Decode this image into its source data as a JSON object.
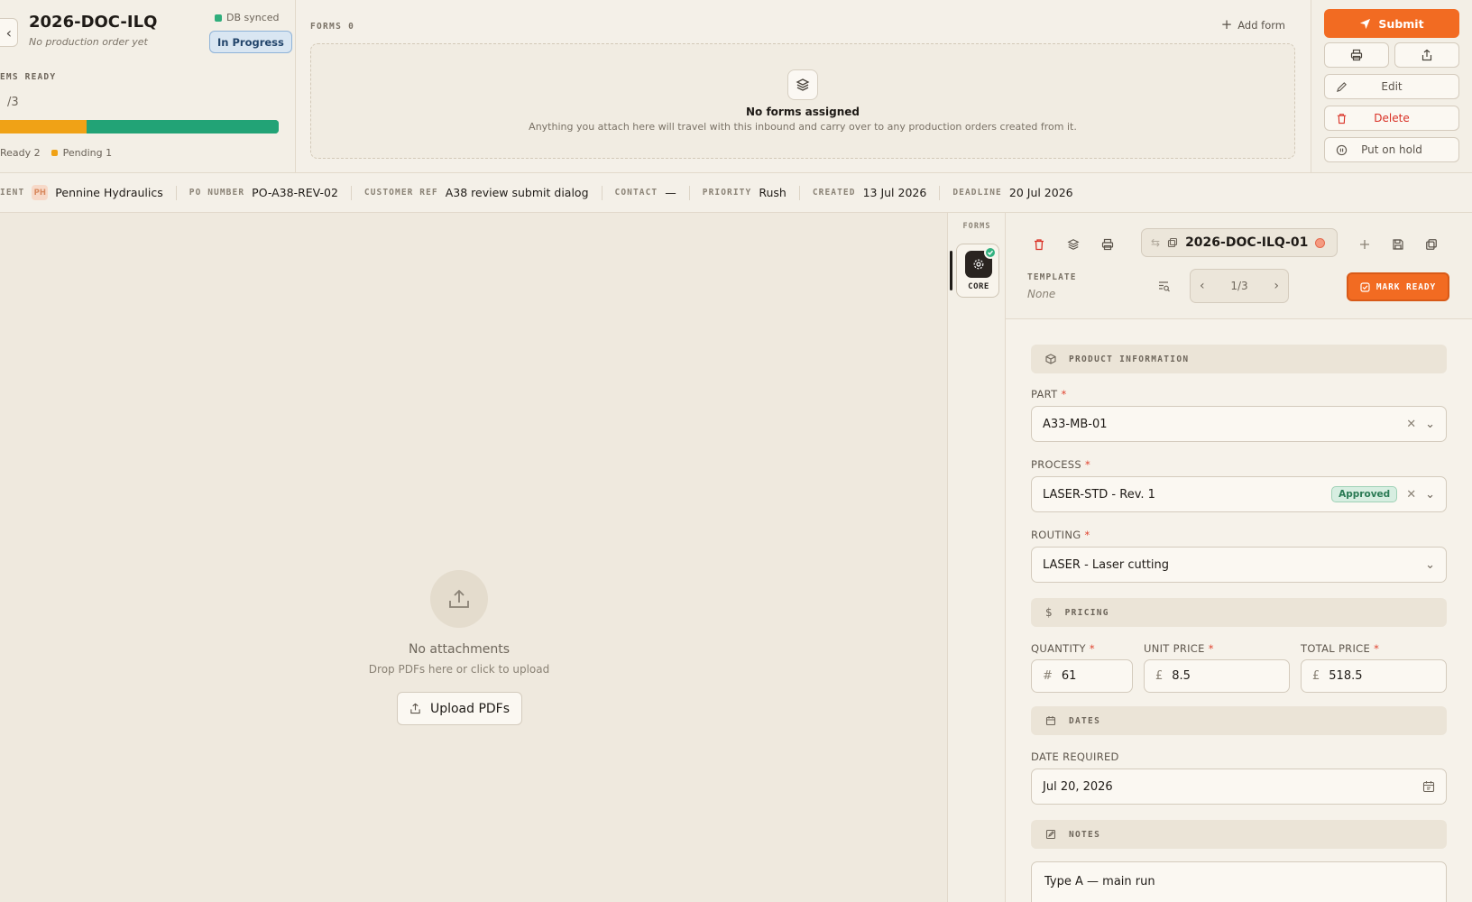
{
  "header": {
    "doc_id": "2026-DOC-ILQ",
    "subtitle": "No production order yet",
    "sync_status": "DB synced",
    "status": "In Progress",
    "items_ready_label": "EMS READY",
    "items_count": "/3",
    "progress": {
      "pending_fraction": 0.31,
      "ready_fraction": 0.69,
      "pending_color": "#f0a216",
      "ready_color": "#22a376"
    },
    "legend_ready": "Ready 2",
    "legend_pending": "Pending 1"
  },
  "forms_panel": {
    "label": "FORMS 0",
    "add_form": "Add form",
    "empty_title": "No forms assigned",
    "empty_desc": "Anything you attach here will travel with this inbound and carry over to any production orders created from it."
  },
  "actions": {
    "submit": "Submit",
    "edit": "Edit",
    "delete": "Delete",
    "hold": "Put on hold"
  },
  "meta": {
    "client_key": "IENT",
    "client_initials": "PH",
    "client_name": "Pennine Hydraulics",
    "po_key": "PO NUMBER",
    "po_val": "PO-A38-REV-02",
    "ref_key": "CUSTOMER REF",
    "ref_val": "A38 review submit dialog",
    "contact_key": "CONTACT",
    "contact_val": "—",
    "priority_key": "PRIORITY",
    "priority_val": "Rush",
    "created_key": "CREATED",
    "created_val": "13 Jul 2026",
    "deadline_key": "DEADLINE",
    "deadline_val": "20 Jul 2026"
  },
  "attachments": {
    "title": "No attachments",
    "desc": "Drop PDFs here or click to upload",
    "upload": "Upload PDFs"
  },
  "rail": {
    "label": "FORMS",
    "item": "CORE"
  },
  "detail": {
    "doc_id": "2026-DOC-ILQ-01",
    "template_label": "TEMPLATE",
    "template_val": "None",
    "pager": "1/3",
    "mark_ready": "MARK READY",
    "sections": {
      "product": "PRODUCT INFORMATION",
      "pricing": "PRICING",
      "dates": "DATES",
      "notes": "NOTES"
    },
    "part_label": "PART",
    "part_val": "A33-MB-01",
    "process_label": "PROCESS",
    "process_val": "LASER-STD - Rev. 1",
    "process_badge": "Approved",
    "routing_label": "ROUTING",
    "routing_val": "LASER - Laser cutting",
    "quantity_label": "QUANTITY",
    "quantity_val": "61",
    "unit_price_label": "UNIT PRICE",
    "unit_price_val": "8.5",
    "total_price_label": "TOTAL PRICE",
    "total_price_val": "518.5",
    "currency": "£",
    "hash": "#",
    "date_required_label": "DATE REQUIRED",
    "date_required_val": "Jul 20, 2026",
    "notes_val": "Type A — main run"
  }
}
